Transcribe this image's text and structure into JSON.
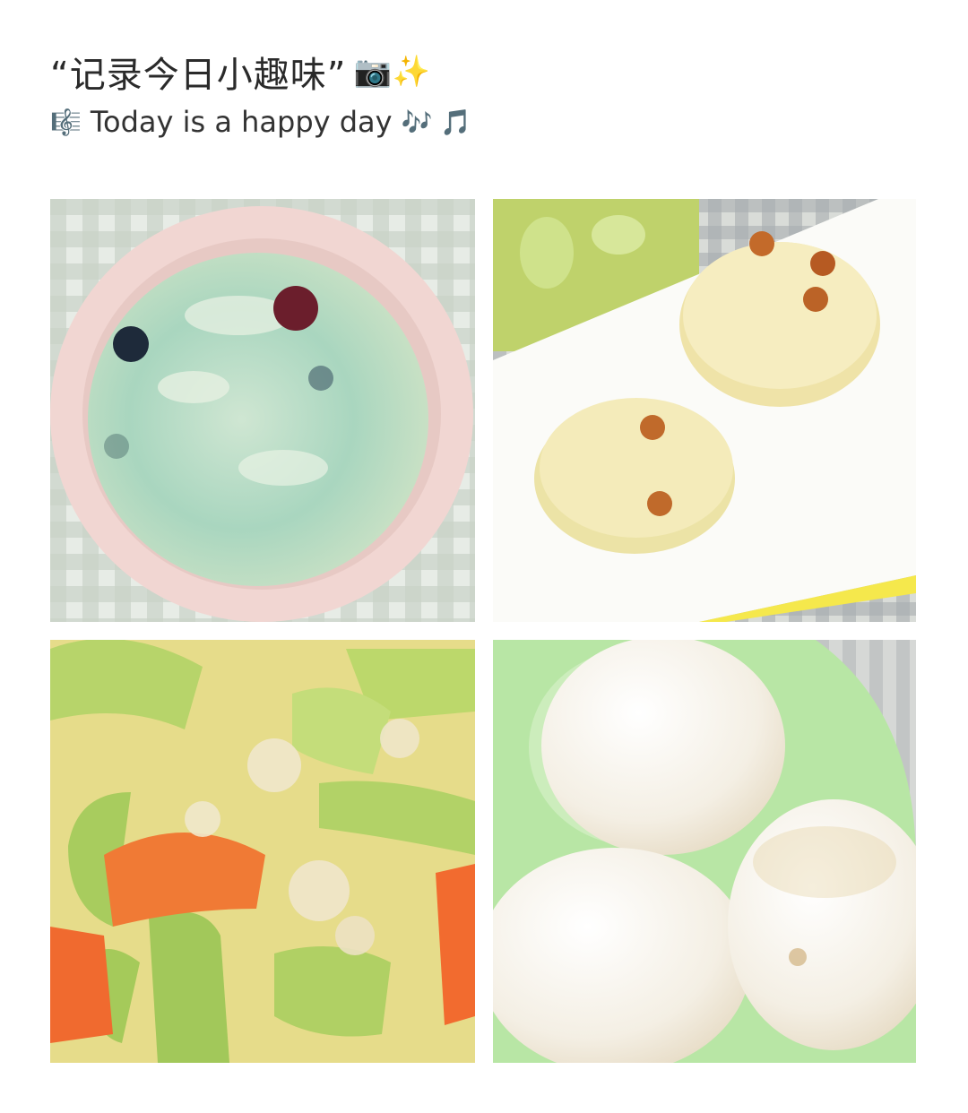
{
  "header": {
    "title": "“记录今日小趣味”",
    "title_emoji": "📷✨",
    "subtitle_icon": "🎼",
    "subtitle": "Today is a happy day",
    "subtitle_trailing_icons": "🎶 🎵"
  },
  "photos": [
    {
      "subject": "porridge-bowl"
    },
    {
      "subject": "steamed-buns-plate"
    },
    {
      "subject": "zucchini-stir-fry"
    },
    {
      "subject": "boiled-eggs"
    }
  ]
}
